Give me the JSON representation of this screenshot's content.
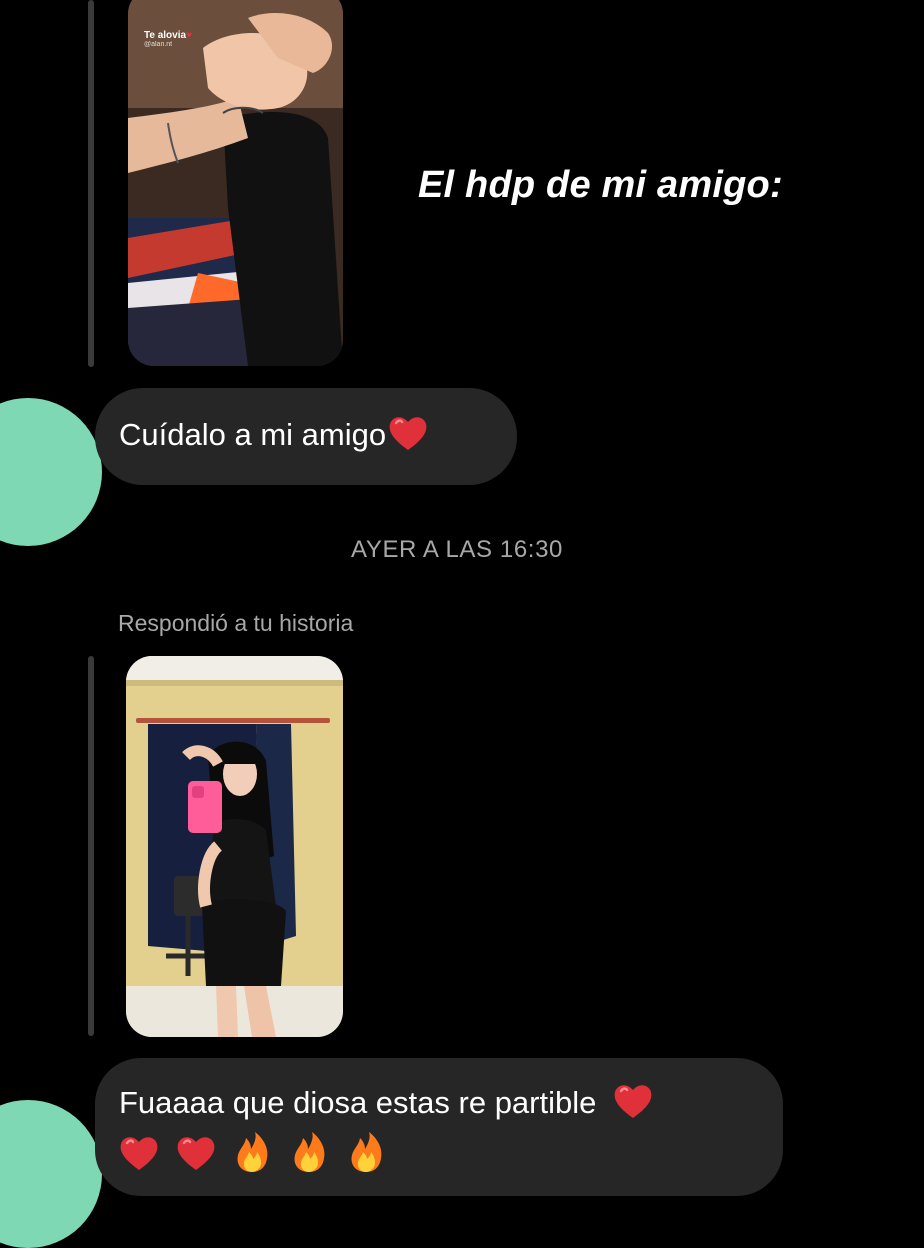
{
  "conversation": {
    "meme_caption": "El hdp de mi amigo:",
    "messages": [
      {
        "text": "Cuídalo a mi amigo",
        "emojis": [
          "red-heart"
        ]
      },
      {
        "text": "Fuaaaa que diosa estas re partible",
        "emojis": [
          "red-heart",
          "red-heart",
          "red-heart",
          "fire",
          "fire",
          "fire"
        ]
      }
    ],
    "timestamp": "AYER A LAS 16:30",
    "story_reply_label": "Respondió a tu historia",
    "story_1": {
      "caption": "Te alovia",
      "caption_handle": "@alan.nt"
    }
  },
  "colors": {
    "background": "#000000",
    "bubble": "#262626",
    "avatar": "#7fd8b4",
    "meta_text": "#a8a8a8",
    "heart": "#e0303a",
    "fire": "#ff8a1f"
  },
  "icons": {
    "heart": "red-heart-emoji",
    "fire": "fire-emoji"
  }
}
